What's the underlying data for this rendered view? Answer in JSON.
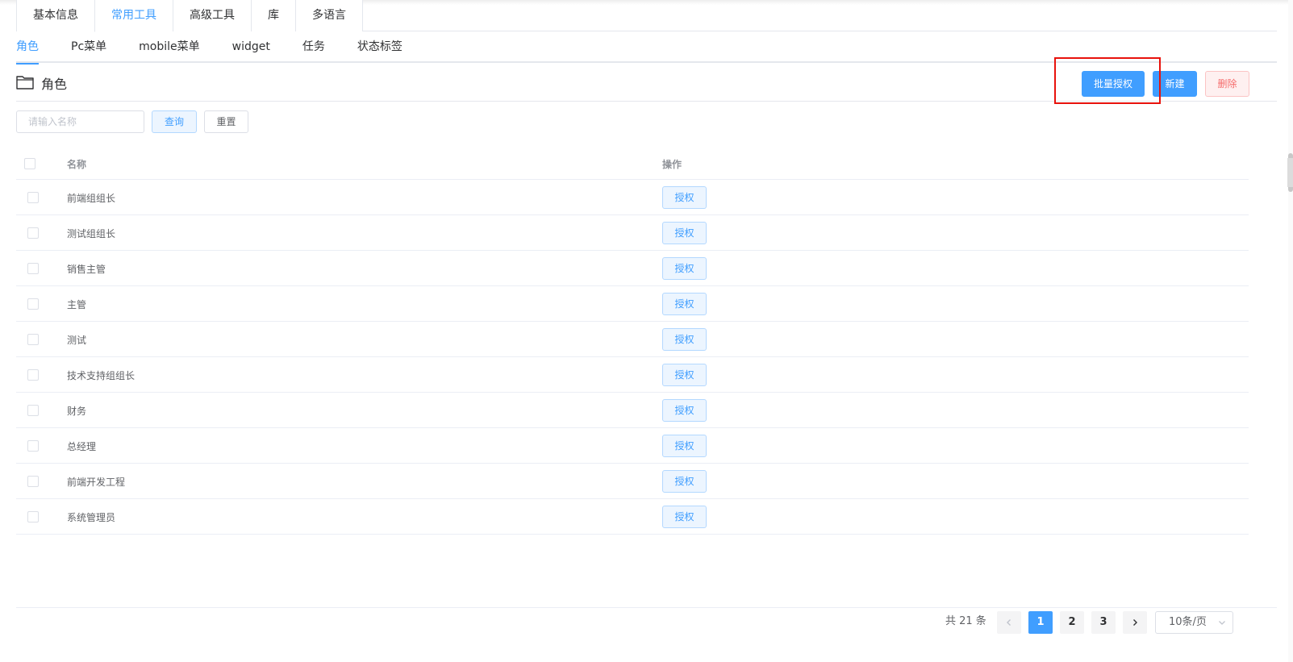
{
  "top_tabs": [
    {
      "label": "基本信息",
      "active": false
    },
    {
      "label": "常用工具",
      "active": true
    },
    {
      "label": "高级工具",
      "active": false
    },
    {
      "label": "库",
      "active": false
    },
    {
      "label": "多语言",
      "active": false
    }
  ],
  "sub_tabs": [
    {
      "label": "角色",
      "active": true
    },
    {
      "label": "Pc菜单",
      "active": false
    },
    {
      "label": "mobile菜单",
      "active": false
    },
    {
      "label": "widget",
      "active": false
    },
    {
      "label": "任务",
      "active": false
    },
    {
      "label": "状态标签",
      "active": false
    }
  ],
  "header": {
    "title": "角色",
    "batch_authorize_label": "批量授权",
    "new_label": "新建",
    "delete_label": "删除"
  },
  "search": {
    "placeholder": "请输入名称",
    "value": "",
    "query_label": "查询",
    "reset_label": "重置"
  },
  "table": {
    "columns": {
      "name": "名称",
      "operations": "操作"
    },
    "rows": [
      {
        "name": "前端组组长",
        "action": "授权"
      },
      {
        "name": "测试组组长",
        "action": "授权"
      },
      {
        "name": "销售主管",
        "action": "授权"
      },
      {
        "name": "主管",
        "action": "授权"
      },
      {
        "name": "测试",
        "action": "授权"
      },
      {
        "name": "技术支持组组长",
        "action": "授权"
      },
      {
        "name": "财务",
        "action": "授权"
      },
      {
        "name": "总经理",
        "action": "授权"
      },
      {
        "name": "前端开发工程",
        "action": "授权"
      },
      {
        "name": "系统管理员",
        "action": "授权"
      }
    ]
  },
  "pagination": {
    "total_text": "共 21 条",
    "pages": [
      "1",
      "2",
      "3"
    ],
    "current_page": "1",
    "page_size_label": "10条/页"
  },
  "colors": {
    "accent": "#409eff",
    "danger": "#f56c6c",
    "highlight": "#e8120c"
  },
  "icons": {
    "folder": "folder-icon",
    "prev": "chevron-left-icon",
    "next": "chevron-right-icon",
    "select": "chevron-down-icon"
  }
}
